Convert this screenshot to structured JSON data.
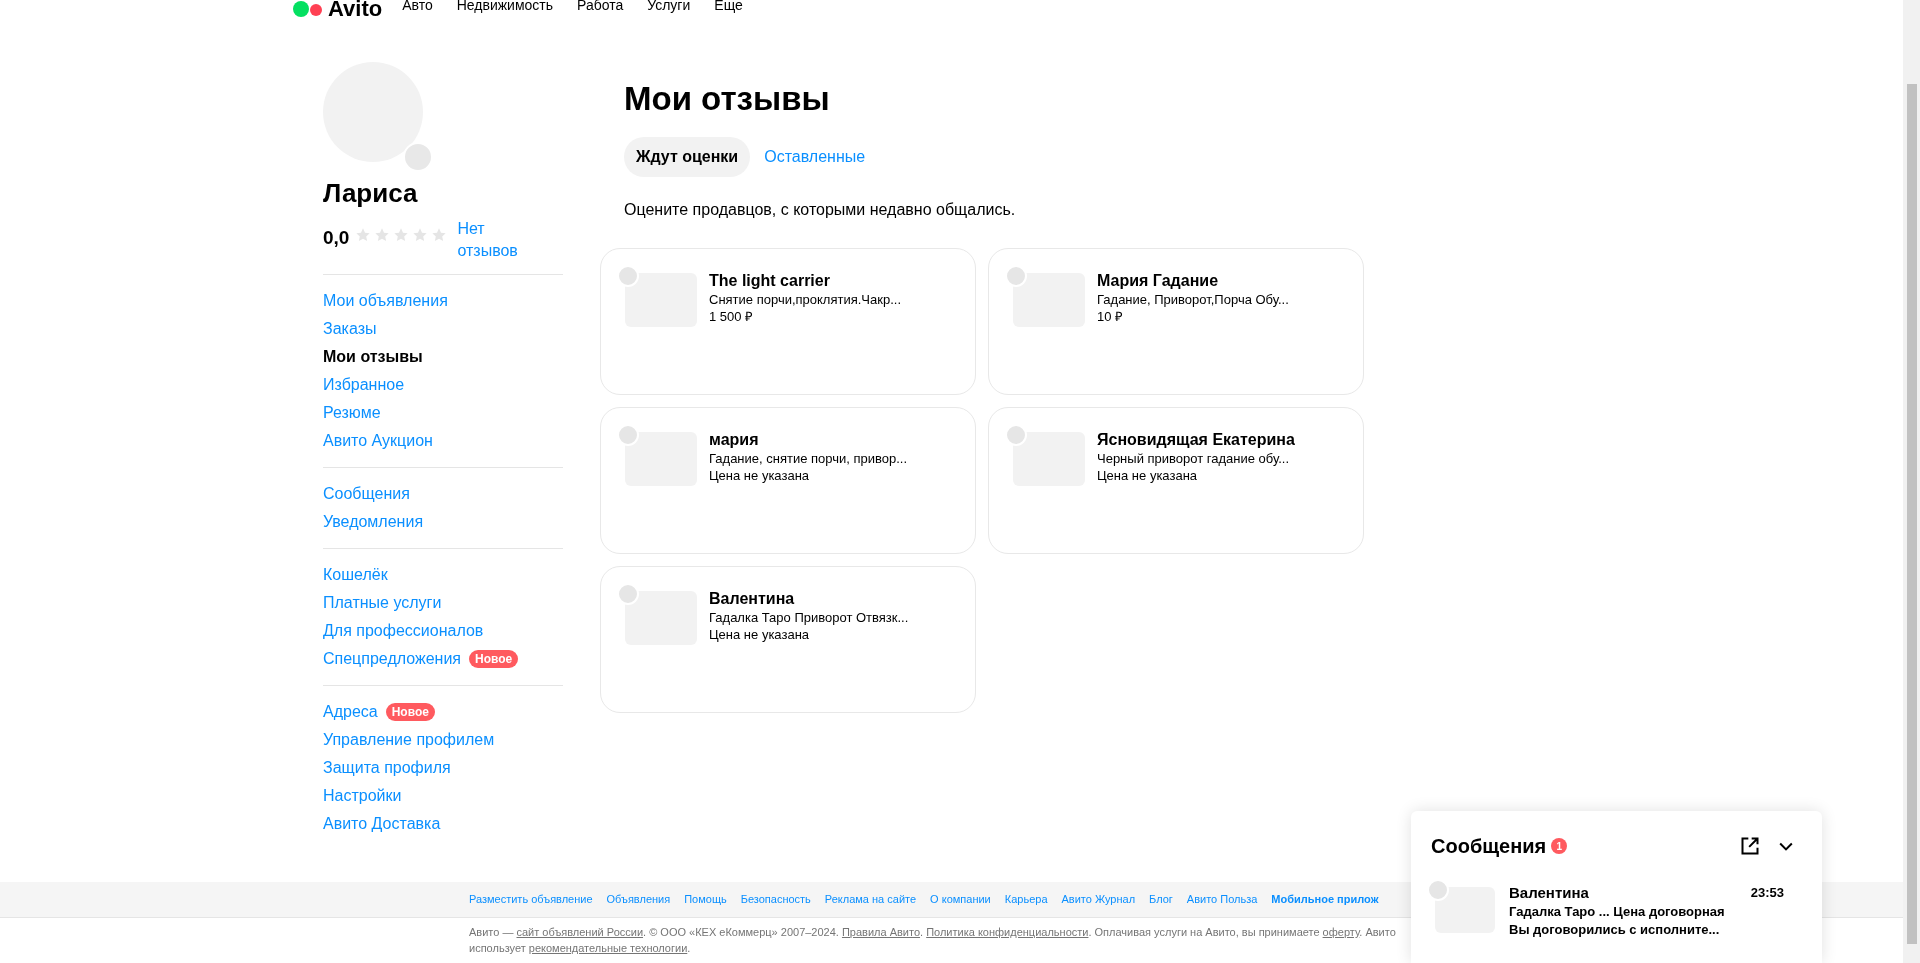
{
  "header": {
    "logo": "Avito",
    "nav": [
      "Авто",
      "Недвижимость",
      "Работа",
      "Услуги",
      "Еще"
    ]
  },
  "profile": {
    "name": "Лариса",
    "rating": "0,0",
    "stars": 0,
    "reviews_link": "Нет отзывов"
  },
  "sidebar": {
    "groups": [
      [
        {
          "label": "Мои объявления",
          "selected": false
        },
        {
          "label": "Заказы",
          "selected": false
        },
        {
          "label": "Мои отзывы",
          "selected": true
        },
        {
          "label": "Избранное",
          "selected": false
        },
        {
          "label": "Резюме",
          "selected": false
        },
        {
          "label": "Авито Аукцион",
          "selected": false
        }
      ],
      [
        {
          "label": "Сообщения",
          "selected": false
        },
        {
          "label": "Уведомления",
          "selected": false
        }
      ],
      [
        {
          "label": "Кошелёк",
          "selected": false
        },
        {
          "label": "Платные услуги",
          "selected": false
        },
        {
          "label": "Для профессионалов",
          "selected": false
        },
        {
          "label": "Спецпредложения",
          "selected": false,
          "badge": "Новое"
        }
      ],
      [
        {
          "label": "Адреса",
          "selected": false,
          "badge": "Новое"
        },
        {
          "label": "Управление профилем",
          "selected": false
        },
        {
          "label": "Защита профиля",
          "selected": false
        },
        {
          "label": "Настройки",
          "selected": false
        },
        {
          "label": "Авито Доставка",
          "selected": false
        }
      ]
    ]
  },
  "page": {
    "title": "Мои отзывы",
    "tabs": [
      {
        "label": "Ждут оценки",
        "selected": true
      },
      {
        "label": "Оставленные",
        "selected": false
      }
    ],
    "hint": "Оцените продавцов, с которыми недавно общались.",
    "cards": [
      {
        "seller": "The light carrier",
        "ad": "Снятие порчи,проклятия.Чакр...",
        "price": "1 500 ₽"
      },
      {
        "seller": "Мария Гадание",
        "ad": "Гадание, Приворот,Порча Обу...",
        "price": "10 ₽"
      },
      {
        "seller": "мария",
        "ad": "Гадание, снятие порчи, привор...",
        "price": "Цена не указана"
      },
      {
        "seller": "Ясновидящая Екатерина",
        "ad": "Черный приворот гадание обу...",
        "price": "Цена не указана"
      },
      {
        "seller": "Валентина",
        "ad": "Гадалка Таро Приворот Отвязк...",
        "price": "Цена не указана"
      }
    ]
  },
  "footer": {
    "links": [
      {
        "label": "Разместить объявление",
        "bold": false
      },
      {
        "label": "Объявления",
        "bold": false
      },
      {
        "label": "Помощь",
        "bold": false
      },
      {
        "label": "Безопасность",
        "bold": false
      },
      {
        "label": "Реклама на сайте",
        "bold": false
      },
      {
        "label": "О компании",
        "bold": false
      },
      {
        "label": "Карьера",
        "bold": false
      },
      {
        "label": "Авито Журнал",
        "bold": false
      },
      {
        "label": "Блог",
        "bold": false
      },
      {
        "label": "Авито Польза",
        "bold": false
      },
      {
        "label": "Мобильное прилож",
        "bold": true
      }
    ],
    "legal": [
      {
        "text": "Авито — ",
        "link": false
      },
      {
        "text": "сайт объявлений России",
        "link": true
      },
      {
        "text": ". © ООО «КЕХ еКоммерц» 2007–2024. ",
        "link": false
      },
      {
        "text": "Правила Авито",
        "link": true
      },
      {
        "text": ". ",
        "link": false
      },
      {
        "text": "Политика конфиденциальности",
        "link": true
      },
      {
        "text": ". Оплачивая услуги на Авито, вы принимаете ",
        "link": false
      },
      {
        "text": "оферту",
        "link": true
      },
      {
        "text": ". Авито использует ",
        "link": false
      },
      {
        "text": "рекомендательные технологии",
        "link": true
      },
      {
        "text": ".",
        "link": false
      }
    ]
  },
  "messages": {
    "title": "Сообщения",
    "unread": "1",
    "chats": [
      {
        "name": "Валентина",
        "time": "23:53",
        "ad": "Гадалка Таро ... Цена договорная",
        "last": "Вы договорились с исполните..."
      }
    ]
  }
}
